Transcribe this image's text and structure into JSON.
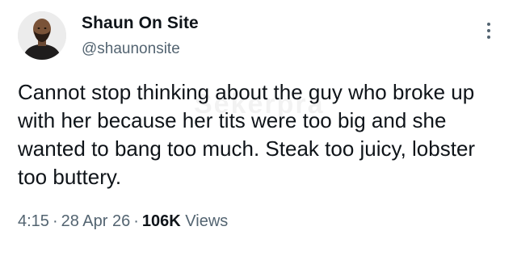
{
  "author": {
    "display_name": "Shaun On Site",
    "handle": "@shaunonsite",
    "avatar_icon": "user-avatar"
  },
  "menu": {
    "icon": "more-vertical-icon"
  },
  "tweet": {
    "text": "Cannot stop thinking about the guy who broke up with her because her tits were too big and she wanted to bang too much. Steak too juicy, lobster too buttery.",
    "watermark": "Sekerpra"
  },
  "meta": {
    "time": "4:15",
    "separator": "·",
    "date": "28 Apr 26",
    "views_count": "106K",
    "views_label": "Views"
  },
  "colors": {
    "text_primary": "#0f1419",
    "text_secondary": "#536471",
    "background": "#ffffff"
  }
}
